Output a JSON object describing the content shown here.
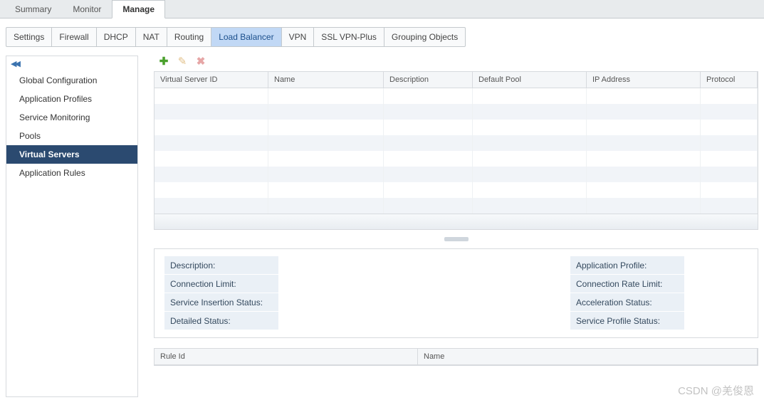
{
  "top_tabs": {
    "summary": "Summary",
    "monitor": "Monitor",
    "manage": "Manage"
  },
  "sub_tabs": {
    "settings": "Settings",
    "firewall": "Firewall",
    "dhcp": "DHCP",
    "nat": "NAT",
    "routing": "Routing",
    "load_balancer": "Load Balancer",
    "vpn": "VPN",
    "ssl_vpn_plus": "SSL VPN-Plus",
    "grouping": "Grouping Objects"
  },
  "sidebar": {
    "items": [
      {
        "label": "Global Configuration"
      },
      {
        "label": "Application Profiles"
      },
      {
        "label": "Service Monitoring"
      },
      {
        "label": "Pools"
      },
      {
        "label": "Virtual Servers"
      },
      {
        "label": "Application Rules"
      }
    ]
  },
  "grid": {
    "columns": {
      "id": "Virtual Server ID",
      "name": "Name",
      "desc": "Description",
      "pool": "Default Pool",
      "ip": "IP Address",
      "proto": "Protocol"
    }
  },
  "detail": {
    "left": {
      "desc": "Description:",
      "conn_limit": "Connection Limit:",
      "svc_ins": "Service Insertion Status:",
      "detailed": "Detailed Status:"
    },
    "right": {
      "app_profile": "Application Profile:",
      "conn_rate": "Connection Rate Limit:",
      "accel": "Acceleration Status:",
      "svc_profile": "Service Profile Status:"
    }
  },
  "rule_grid": {
    "columns": {
      "id": "Rule Id",
      "name": "Name"
    }
  },
  "watermark": "CSDN @羌俊恩"
}
